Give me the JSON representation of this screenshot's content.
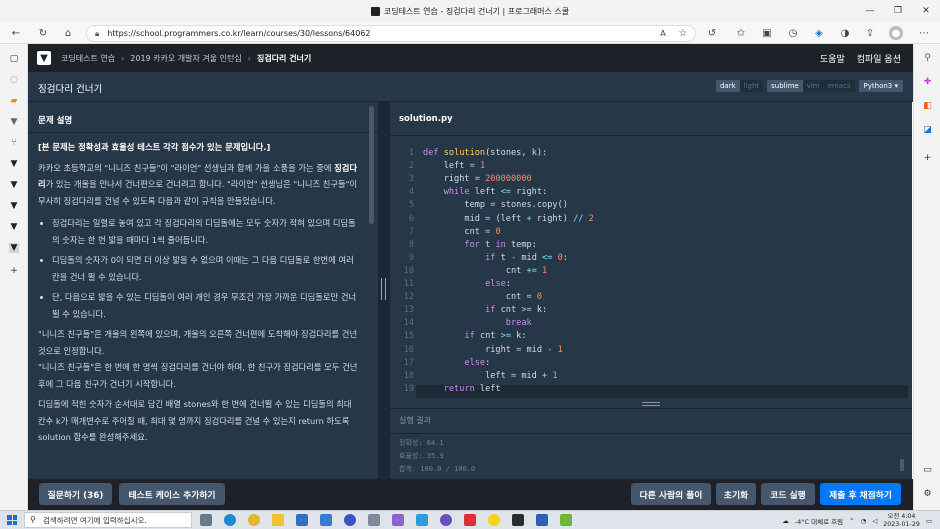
{
  "browser": {
    "window_title": "코딩테스트 연습 - 징검다리 건너기 | 프로그래머스 스쿨",
    "url": "https://school.programmers.co.kr/learn/courses/30/lessons/64062",
    "controls": [
      "—",
      "❐",
      "✕"
    ]
  },
  "site_header": {
    "breadcrumbs": [
      "코딩테스트 연습",
      "2019 카카오 개발자 겨울 인턴십",
      "징검다리 건너기"
    ],
    "help": "도움말",
    "compile_options": "컴파일 옵션"
  },
  "problem": {
    "title": "징검다리 건너기",
    "desc_heading": "문제 설명",
    "intro": "[본 문제는 정확성과 효율성 테스트 각각 점수가 있는 문제입니다.]",
    "para1_a": "카카오 초등학교의 \"니니즈 친구들\"이 \"라이언\" 선생님과 함께 가을 소풍을 가는 중에 ",
    "para1_b": "징검다리",
    "para1_c": "가 있는 개울을 만나서 건너편으로 건너려고 합니다. \"라이언\" 선생님은 \"니니즈 친구들\"이 무사히 징검다리를 건널 수 있도록 다음과 같이 규칙을 만들었습니다.",
    "rules": [
      "징검다리는 일렬로 놓여 있고 각 징검다리의 디딤돌에는 모두 숫자가 적혀 있으며 디딤돌의 숫자는 한 번 밟을 때마다 1씩 줄어듭니다.",
      "디딤돌의 숫자가 0이 되면 더 이상 밟을 수 없으며 이때는 그 다음 디딤돌로 한번에 여러 칸을 건너 뛸 수 있습니다.",
      "단, 다음으로 밟을 수 있는 디딤돌이 여러 개인 경우 무조건 가장 가까운 디딤돌로만 건너뛸 수 있습니다."
    ],
    "para2": "\"니니즈 친구들\"은 개울의 왼쪽에 있으며, 개울의 오른쪽 건너편에 도착해야 징검다리를 건넌 것으로 인정합니다.",
    "para3": "\"니니즈 친구들\"은 한 번에 한 명씩 징검다리를 건너야 하며, 한 친구가 징검다리를 모두 건넌 후에 그 다음 친구가 건너기 시작합니다.",
    "para4": "디딤돌에 적힌 숫자가 순서대로 담긴 배열 stones와 한 번에 건너뛸 수 있는 디딤돌의 최대 칸수 k가 매개변수로 주어질 때, 최대 몇 명까지 징검다리를 건널 수 있는지 return 하도록 solution 함수를 완성해주세요."
  },
  "editor_toggles": {
    "theme": [
      "dark",
      "light"
    ],
    "keymap": [
      "sublime",
      "vim",
      "emacs"
    ],
    "language": "Python3 ▾"
  },
  "editor": {
    "filename": "solution.py",
    "line_numbers": [
      "1",
      "2",
      "3",
      "4",
      "5",
      "6",
      "7",
      "8",
      "9",
      "10",
      "11",
      "12",
      "13",
      "14",
      "15",
      "16",
      "17",
      "18",
      "19"
    ],
    "lines": [
      "def solution(stones, k):",
      "    left = 1",
      "    right = 200000000",
      "    while left <= right:",
      "        temp = stones.copy()",
      "        mid = (left + right) // 2",
      "        cnt = 0",
      "        for t in temp:",
      "            if t - mid <= 0:",
      "                cnt += 1",
      "            else:",
      "                cnt = 0",
      "            if cnt >= k:",
      "                break",
      "        if cnt >= k:",
      "            right = mid - 1",
      "        else:",
      "            left = mid + 1",
      "    return left"
    ]
  },
  "output": {
    "label": "실행 결과",
    "results": [
      "정확성: 64.1",
      "효율성: 35.9",
      "합계: 100.0 / 100.0"
    ]
  },
  "actions": {
    "questions": "질문하기 (36)",
    "add_test": "테스트 케이스 추가하기",
    "others": "다른 사람의 풀이",
    "reset": "초기화",
    "run": "코드 실행",
    "submit": "제출 후 채점하기"
  },
  "taskbar": {
    "search_placeholder": "검색하려면 여기에 입력하십시오.",
    "weather": "-4°C 대체로 흐림",
    "time": "오전 4:04",
    "date": "2023-01-29"
  },
  "colors": {
    "header_bg": "#1e2228",
    "panel_bg": "#263747",
    "primary": "#0078ff",
    "button_bg": "#44576c"
  }
}
